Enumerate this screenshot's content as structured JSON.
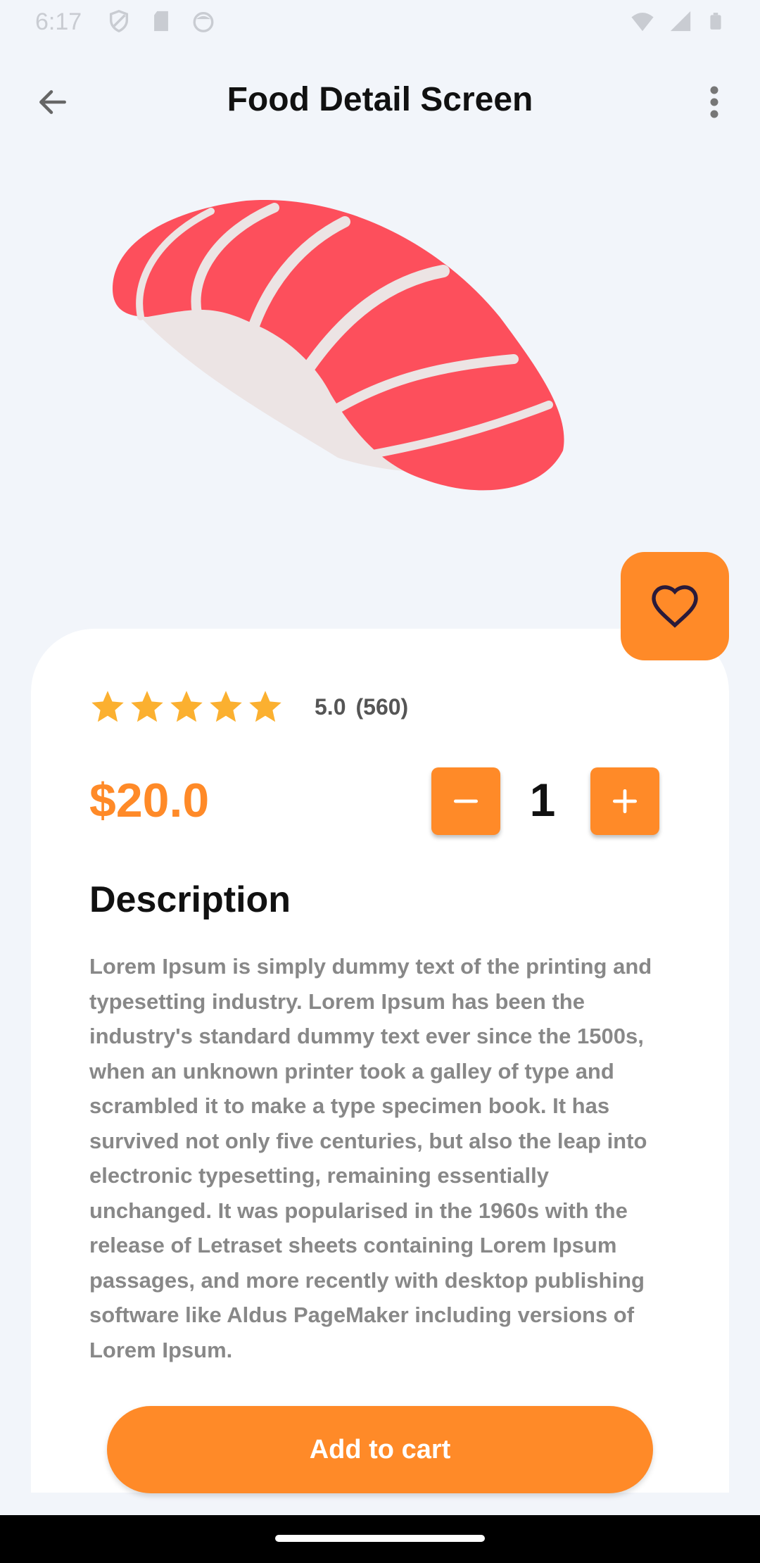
{
  "status_bar": {
    "time": "6:17",
    "left_icons": [
      "shield-icon",
      "sd-card-icon",
      "face-icon"
    ],
    "right_icons": [
      "wifi-icon",
      "signal-icon",
      "battery-icon"
    ]
  },
  "app_bar": {
    "title": "Food Detail Screen",
    "back_icon": "arrow-back-icon",
    "menu_icon": "more-vertical-icon"
  },
  "food": {
    "image": "salmon-sushi-illustration",
    "favorite_icon": "heart-outline-icon"
  },
  "rating": {
    "stars": 5,
    "value": "5.0",
    "count": "(560)"
  },
  "price": "$20.0",
  "quantity": {
    "value": "1",
    "minus_icon": "minus-icon",
    "plus_icon": "plus-icon"
  },
  "description": {
    "title": "Description",
    "body": "Lorem Ipsum is simply dummy text of the printing and typesetting industry. Lorem Ipsum has been the industry's standard dummy text ever since the 1500s, when an unknown printer took a galley of type and scrambled it to make a type specimen book. It has survived not only five centuries, but also the leap into electronic typesetting, remaining essentially unchanged. It was popularised in the 1960s with the release of Letraset sheets containing Lorem Ipsum passages, and more recently with desktop publishing software like Aldus PageMaker including versions of Lorem Ipsum."
  },
  "add_to_cart": "Add to cart",
  "colors": {
    "accent": "#ff8a28",
    "background": "#f2f5fa",
    "card": "#ffffff",
    "star": "#fbb030",
    "fish": "#fd4f5c",
    "rice": "#ece4e4"
  }
}
